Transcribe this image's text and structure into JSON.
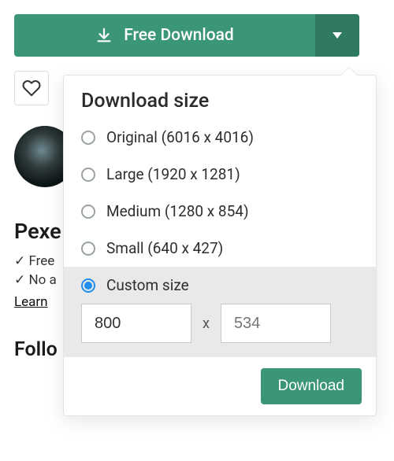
{
  "download_button": {
    "label": "Free Download"
  },
  "left": {
    "brand": "Pexe",
    "feature1": "✓ Free",
    "feature2": "✓ No a",
    "learn": "Learn",
    "follow": "Follo"
  },
  "panel": {
    "title": "Download size",
    "options": [
      {
        "label": "Original (6016 x 4016)",
        "selected": false
      },
      {
        "label": "Large (1920 x 1281)",
        "selected": false
      },
      {
        "label": "Medium (1280 x 854)",
        "selected": false
      },
      {
        "label": "Small (640 x 427)",
        "selected": false
      }
    ],
    "custom": {
      "label": "Custom size",
      "selected": true,
      "width_value": "800",
      "height_placeholder": "534"
    },
    "go_label": "Download"
  }
}
